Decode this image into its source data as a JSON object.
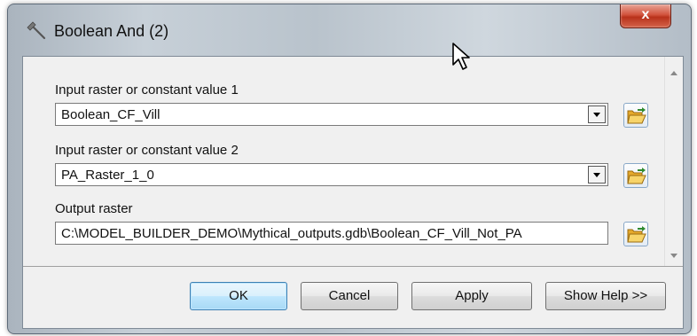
{
  "window": {
    "title": "Boolean And (2)",
    "close_glyph": "x"
  },
  "fields": [
    {
      "label": "Input raster or constant value 1",
      "value": "Boolean_CF_Vill",
      "type": "dropdown"
    },
    {
      "label": "Input raster or constant value 2",
      "value": "PA_Raster_1_0",
      "type": "dropdown"
    },
    {
      "label": "Output raster",
      "value": "C:\\MODEL_BUILDER_DEMO\\Mythical_outputs.gdb\\Boolean_CF_Vill_Not_PA",
      "type": "text"
    }
  ],
  "buttons": {
    "ok": "OK",
    "cancel": "Cancel",
    "apply": "Apply",
    "help": "Show Help >>"
  },
  "icons": {
    "title": "hammer-icon",
    "browse": "open-folder-icon",
    "cursor": "mouse-pointer-icon"
  },
  "colors": {
    "close_button": "#c8452e",
    "default_button_border": "#3c7fb1",
    "folder": "#f2c14e"
  }
}
